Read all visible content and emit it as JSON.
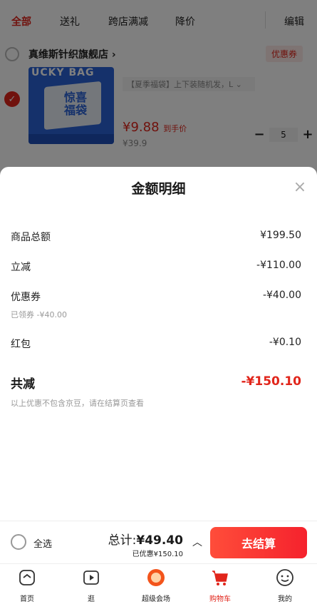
{
  "top_tabs": {
    "items": [
      "全部",
      "送礼",
      "跨店满减",
      "降价"
    ],
    "edit": "编辑"
  },
  "shop": {
    "name": "真维斯针织旗舰店 ›",
    "coupon": "优惠券"
  },
  "product": {
    "banner": "UCKY BAG",
    "box_text": "惊喜福袋",
    "spec": "【夏季福袋】上下装随机发，L ⌄",
    "price_symbol": "¥",
    "price": "9.88",
    "price_suffix": "到手价",
    "original_price": "¥39.9",
    "qty": "5",
    "minus": "−",
    "plus": "+"
  },
  "sheet": {
    "title": "金额明细",
    "close": "×",
    "rows": [
      {
        "label": "商品总额",
        "value": "¥199.50"
      },
      {
        "label": "立减",
        "value": "-¥110.00"
      },
      {
        "label": "优惠券",
        "value": "-¥40.00",
        "sub": "已领券 -¥40.00"
      },
      {
        "label": "红包",
        "value": "-¥0.10"
      }
    ],
    "total_label": "共减",
    "total_value": "-¥150.10",
    "note": "以上优惠不包含京豆，请在结算页查看"
  },
  "checkout": {
    "select_all": "全选",
    "total_prefix": "总计:",
    "total_amount": "¥49.40",
    "discount": "已优惠¥150.10",
    "button": "去结算"
  },
  "nav": {
    "items": [
      {
        "label": "首页",
        "icon": "home-icon"
      },
      {
        "label": "逛",
        "icon": "video-icon"
      },
      {
        "label": "超级会场",
        "icon": "super-venue-icon"
      },
      {
        "label": "购物车",
        "icon": "cart-icon"
      },
      {
        "label": "我的",
        "icon": "profile-icon"
      }
    ],
    "active_color": "#e1251b"
  },
  "colors": {
    "accent": "#e1251b",
    "checkout_gradient_start": "#ff4d3a",
    "checkout_gradient_end": "#f5222d"
  }
}
